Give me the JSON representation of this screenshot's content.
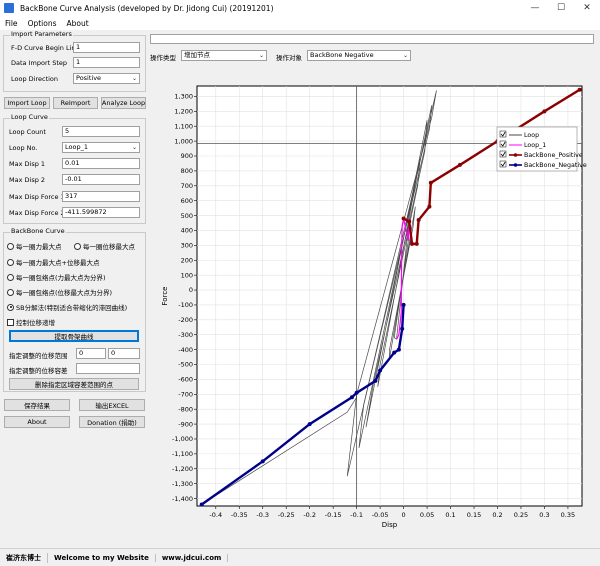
{
  "window": {
    "title": "BackBone Curve Analysis (developed by Dr. Jidong Cui) (20191201)",
    "min": "—",
    "max": "☐",
    "close": "✕"
  },
  "menu": [
    "File",
    "Options",
    "About"
  ],
  "import_params": {
    "legend": "Import Parameters",
    "begin_line_label": "F-D Curve Begin Line",
    "begin_line_value": "1",
    "import_step_label": "Data Import Step",
    "import_step_value": "1",
    "loop_direction_label": "Loop Direction",
    "loop_direction_value": "Positive"
  },
  "buttons": {
    "import_loop": "Import Loop",
    "reimport": "ReImport",
    "analyze_loop": "Analyze Loop"
  },
  "loop_curve": {
    "legend": "Loop Curve",
    "loop_count_label": "Loop Count",
    "loop_count_value": "5",
    "loop_no_label": "Loop No.",
    "loop_no_value": "Loop_1",
    "max_disp1_label": "Max Disp 1",
    "max_disp1_value": "0.01",
    "max_disp2_label": "Max Disp 2",
    "max_disp2_value": "-0.01",
    "max_force1_label": "Max Disp Force 1",
    "max_force1_value": "317",
    "max_force2_label": "Max Disp Force 2",
    "max_force2_value": "-411.599872"
  },
  "backbone": {
    "legend": "BackBone Curve",
    "opt_force_max": "每一圈力最大点",
    "opt_disp_max": "每一圈位移最大点",
    "opt_force_disp_max": "每一圈力最大点+位移最大点",
    "opt_hull_force": "每一圈包络点(力最大点为分界)",
    "opt_hull_disp": "每一圈包络点(位移最大点为分界)",
    "opt_sb": "SB分解法(特别适合带缩化的滞回曲线)",
    "control_disp_increase": "控制位移递增",
    "extract_button": "提取骨架曲线",
    "adjust_range_label": "指定调整的位移范围",
    "range_from": "0",
    "range_to": "0",
    "adjust_tol_label": "指定调整的位移容差",
    "tol_value": "",
    "delete_points_button": "删除指定区域容差范围的点"
  },
  "bottom_buttons": {
    "save": "保存结果",
    "export": "输出EXCEL",
    "about": "About",
    "donation": "Donation (捐助)"
  },
  "toolbar": {
    "op_type_label": "操作类型",
    "op_type_value": "增加节点",
    "op_target_label": "操作对象",
    "op_target_value": "BackBone Negative"
  },
  "status": [
    "崔济东博士",
    "Welcome to my Website",
    "www.jdcui.com"
  ],
  "colors": {
    "loop": "#4a4a4a",
    "loop1": "#ff00ff",
    "backbone_positive": "#8b0000",
    "backbone_negative": "#00008b",
    "crosshair": "#555555"
  },
  "chart_data": {
    "type": "line",
    "xlabel": "Disp",
    "ylabel": "Force",
    "xlim": [
      -0.44,
      0.38
    ],
    "ylim": [
      -1450,
      1370
    ],
    "xticks": [
      "-0.4",
      "-0.35",
      "-0.3",
      "-0.25",
      "-0.2",
      "-0.15",
      "-0.1",
      "-0.05",
      "0",
      "0.05",
      "0.1",
      "0.15",
      "0.2",
      "0.25",
      "0.3",
      "0.35"
    ],
    "yticks": [
      "1,300",
      "1,200",
      "1,100",
      "1,000",
      "900",
      "800",
      "700",
      "600",
      "500",
      "400",
      "300",
      "200",
      "100",
      "0",
      "-100",
      "-200",
      "-300",
      "-400",
      "-500",
      "-600",
      "-700",
      "-800",
      "-900",
      "-1,000",
      "-1,100",
      "-1,200",
      "-1,300",
      "-1,400"
    ],
    "grid": true,
    "legend_position": "top-right",
    "crosshair": {
      "x": -0.1,
      "y": 985
    },
    "series": [
      {
        "name": "Loop",
        "style": "line",
        "paths": [
          [
            [
              -0.02,
              -320
            ],
            [
              0.01,
              330
            ],
            [
              0.012,
              480
            ],
            [
              -0.015,
              -330
            ],
            [
              -0.02,
              -320
            ]
          ],
          [
            [
              -0.03,
              -400
            ],
            [
              0.02,
              420
            ],
            [
              0.025,
              560
            ],
            [
              -0.03,
              -460
            ],
            [
              -0.03,
              -400
            ]
          ],
          [
            [
              -0.05,
              -500
            ],
            [
              0.03,
              700
            ],
            [
              0.035,
              880
            ],
            [
              -0.055,
              -650
            ],
            [
              -0.05,
              -500
            ]
          ],
          [
            [
              -0.065,
              -640
            ],
            [
              0.045,
              930
            ],
            [
              0.05,
              1140
            ],
            [
              -0.08,
              -920
            ],
            [
              -0.065,
              -640
            ]
          ],
          [
            [
              -0.085,
              -770
            ],
            [
              0.055,
              1080
            ],
            [
              0.06,
              1240
            ],
            [
              -0.095,
              -1060
            ],
            [
              -0.085,
              -770
            ]
          ],
          [
            [
              -0.1,
              -700
            ],
            [
              0.06,
              1160
            ],
            [
              0.07,
              1340
            ],
            [
              -0.12,
              -1250
            ],
            [
              -0.1,
              -700
            ]
          ],
          [
            [
              -0.43,
              -1440
            ],
            [
              -0.12,
              -820
            ],
            [
              -0.1,
              -720
            ],
            [
              -0.1,
              -700
            ]
          ],
          [
            [
              0.06,
              720
            ],
            [
              0.375,
              1350
            ]
          ]
        ]
      },
      {
        "name": "Loop_1",
        "style": "line",
        "points": [
          [
            -0.015,
            -330
          ],
          [
            -0.01,
            -300
          ],
          [
            -0.005,
            -150
          ],
          [
            -0.004,
            300
          ],
          [
            -0.003,
            430
          ],
          [
            0.0,
            480
          ],
          [
            0.01,
            330
          ],
          [
            0.012,
            480
          ]
        ]
      },
      {
        "name": "BackBone_Positive",
        "style": "line-marker",
        "points": [
          [
            0.0,
            480
          ],
          [
            0.012,
            460
          ],
          [
            0.018,
            310
          ],
          [
            0.028,
            310
          ],
          [
            0.032,
            470
          ],
          [
            0.055,
            560
          ],
          [
            0.058,
            720
          ],
          [
            0.12,
            840
          ],
          [
            0.2,
            1000
          ],
          [
            0.3,
            1200
          ],
          [
            0.375,
            1345
          ]
        ]
      },
      {
        "name": "BackBone_Negative",
        "style": "line-marker",
        "points": [
          [
            0.0,
            -100
          ],
          [
            -0.003,
            -260
          ],
          [
            -0.01,
            -400
          ],
          [
            -0.02,
            -420
          ],
          [
            -0.05,
            -540
          ],
          [
            -0.06,
            -610
          ],
          [
            -0.1,
            -690
          ],
          [
            -0.11,
            -720
          ],
          [
            -0.2,
            -900
          ],
          [
            -0.3,
            -1150
          ],
          [
            -0.43,
            -1440
          ]
        ]
      }
    ]
  }
}
